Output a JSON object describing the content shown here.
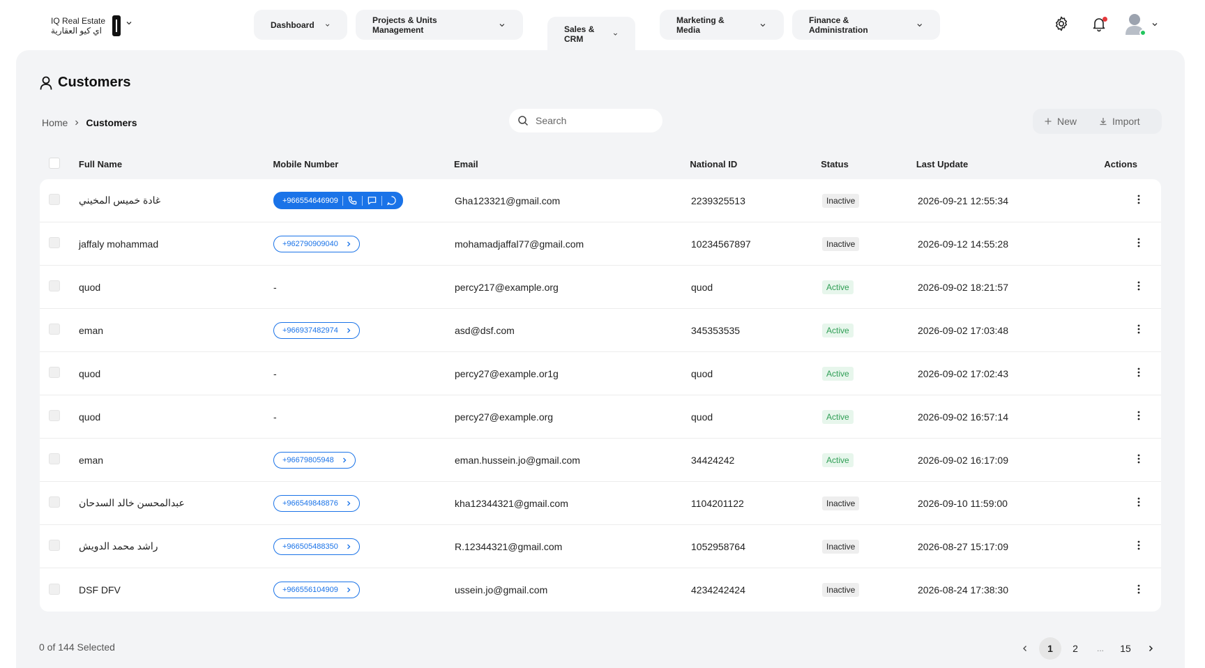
{
  "brand": {
    "name_en": "IQ Real Estate",
    "name_ar": "اي كيو العقارية"
  },
  "nav": [
    {
      "label": "Dashboard"
    },
    {
      "label": "Projects & Units Management"
    },
    {
      "label": "Sales & CRM",
      "active": true
    },
    {
      "label": "Marketing & Media"
    },
    {
      "label": "Finance & Administration"
    }
  ],
  "header_icons": [
    "gear-icon",
    "bell-icon",
    "avatar"
  ],
  "page": {
    "title": "Customers",
    "breadcrumb": [
      "Home",
      "Customers"
    ]
  },
  "search": {
    "placeholder": "Search"
  },
  "toolbar": {
    "new_label": "New",
    "import_label": "Import"
  },
  "table": {
    "columns": [
      "Full Name",
      "Mobile Number",
      "Email",
      "National ID",
      "Status",
      "Last Update",
      "Actions"
    ],
    "rows": [
      {
        "name": "غادة خميس المخيني",
        "mobile": "+966554646909",
        "email": "Gha123321@gmail.com",
        "national_id": "2239325513",
        "status": "Inactive",
        "updated": "2026-09-21 12:55:34"
      },
      {
        "name": "jaffaly mohammad",
        "mobile": "+962790909040",
        "email": "mohamadjaffal77@gmail.com",
        "national_id": "10234567897",
        "status": "Inactive",
        "updated": "2026-09-12 14:55:28"
      },
      {
        "name": "quod",
        "mobile": "-",
        "email": "percy217@example.org",
        "national_id": "quod",
        "status": "Active",
        "updated": "2026-09-02 18:21:57"
      },
      {
        "name": "eman",
        "mobile": "+966937482974",
        "email": "asd@dsf.com",
        "national_id": "345353535",
        "status": "Active",
        "updated": "2026-09-02 17:03:48"
      },
      {
        "name": "quod",
        "mobile": "-",
        "email": "percy27@example.or1g",
        "national_id": "quod",
        "status": "Active",
        "updated": "2026-09-02 17:02:43"
      },
      {
        "name": "quod",
        "mobile": "-",
        "email": "percy27@example.org",
        "national_id": "quod",
        "status": "Active",
        "updated": "2026-09-02 16:57:14"
      },
      {
        "name": "eman",
        "mobile": "+96679805948",
        "email": "eman.hussein.jo@gmail.com",
        "national_id": "34424242",
        "status": "Active",
        "updated": "2026-09-02 16:17:09"
      },
      {
        "name": "عبدالمحسن خالد السدحان",
        "mobile": "+966549848876",
        "email": "kha12344321@gmail.com",
        "national_id": "1104201122",
        "status": "Inactive",
        "updated": "2026-09-10 11:59:00"
      },
      {
        "name": "راشد محمد الدويش",
        "mobile": "+966505488350",
        "email": "R.12344321@gmail.com",
        "national_id": "1052958764",
        "status": "Inactive",
        "updated": "2026-08-27 15:17:09"
      },
      {
        "name": "DSF DFV",
        "mobile": "+966556104909",
        "email": "ussein.jo@gmail.com",
        "national_id": "4234242424",
        "status": "Inactive",
        "updated": "2026-08-24 17:38:30"
      }
    ]
  },
  "footer": {
    "selected_text": "0 of 144 Selected",
    "pages": [
      "1",
      "2",
      "...",
      "15"
    ],
    "current_page": "1"
  },
  "colors": {
    "accent": "#1a73e8",
    "active_text": "#2f9e55",
    "active_bg": "#e7f6ec",
    "inactive_bg": "#eeeeee",
    "notif_dot": "#e5383b",
    "online": "#22c55e"
  }
}
